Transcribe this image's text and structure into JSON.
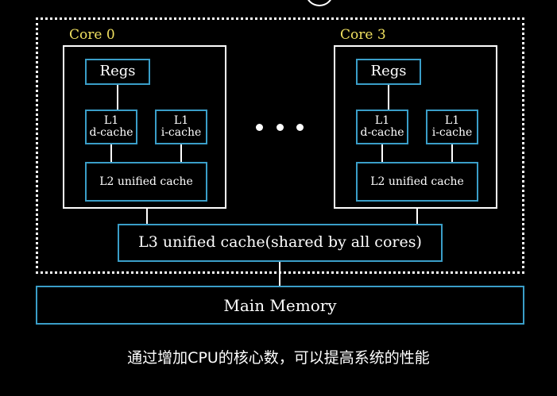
{
  "diagram": {
    "cores": [
      {
        "title": "Core 0",
        "regs": "Regs",
        "l1d": {
          "line1": "L1",
          "line2": "d-cache"
        },
        "l1i": {
          "line1": "L1",
          "line2": "i-cache"
        },
        "l2": "L2 unified cache"
      },
      {
        "title": "Core 3",
        "regs": "Regs",
        "l1d": {
          "line1": "L1",
          "line2": "d-cache"
        },
        "l1i": {
          "line1": "L1",
          "line2": "i-cache"
        },
        "l2": "L2 unified cache"
      }
    ],
    "l3": "L3 unified cache(shared by all cores)",
    "main_memory": "Main Memory"
  },
  "caption": "通过增加CPU的核心数，可以提高系统的性能",
  "colors": {
    "background": "#000000",
    "box_border": "#3a9ec8",
    "core_title": "#f0e060",
    "line": "#ffffff"
  }
}
